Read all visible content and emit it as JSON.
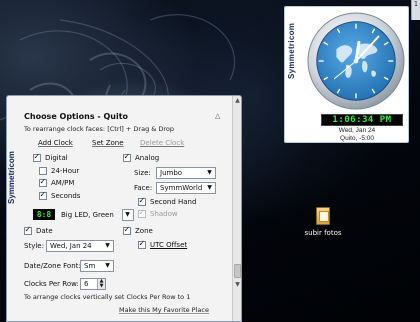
{
  "desktop": {
    "icon_label": "subir fotos"
  },
  "clock_gadget": {
    "brand": "Symmetricom",
    "digital_time": "1:06:34 PM",
    "date": "Wed, Jan 24",
    "zone": "Quito, -5:00",
    "edge_tab": "1"
  },
  "options": {
    "brand": "Symmetricom",
    "title": "Choose Options - Quito",
    "collapse_symbol": "△",
    "hint": "To rearrange clock faces: [Ctrl] + Drag & Drop",
    "add_clock": "Add Clock",
    "set_zone": "Set Zone",
    "delete_clock": "Delete Clock",
    "digital": {
      "label": "Digital",
      "checked": true
    },
    "hour24": {
      "label": "24-Hour",
      "checked": false
    },
    "ampm": {
      "label": "AM/PM",
      "checked": true
    },
    "seconds": {
      "label": "Seconds",
      "checked": true
    },
    "analog": {
      "label": "Analog",
      "checked": true
    },
    "size_label": "Size:",
    "size_value": "Jumbo",
    "face_label": "Face:",
    "face_value": "SymmWorld",
    "second_hand": {
      "label": "Second Hand",
      "checked": true
    },
    "shadow": {
      "label": "Shadow",
      "checked": true
    },
    "led_sample": "8:8",
    "led_style": "Big LED, Green",
    "date": {
      "label": "Date",
      "checked": true
    },
    "style_label": "Style:",
    "style_value": "Wed, Jan 24",
    "zone": {
      "label": "Zone",
      "checked": true
    },
    "utc_offset": {
      "label": "UTC Offset",
      "checked": true
    },
    "font_label": "Date/Zone Font:",
    "font_value": "Sm",
    "clocks_per_row_label": "Clocks Per Row:",
    "clocks_per_row_value": "6",
    "footer_note": "To arrange clocks vertically set Clocks Per Row to 1",
    "favorite_link": "Make this My Favorite Place"
  },
  "colors": {
    "led_green": "#2bf03a",
    "clock_blue": "#2f86c9",
    "brand_navy": "#1c2f5e"
  }
}
